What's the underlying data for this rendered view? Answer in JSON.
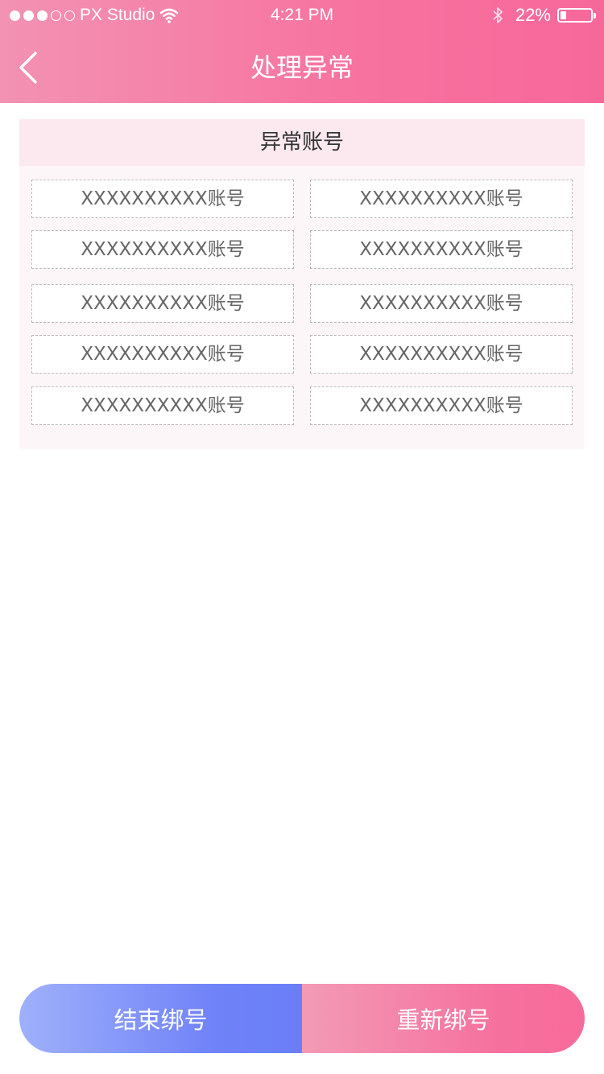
{
  "status_bar": {
    "carrier": "PX Studio",
    "time": "4:21 PM",
    "battery": "22%",
    "signal_icon": "signal-dots-icon",
    "wifi_icon": "wifi-icon",
    "bluetooth_icon": "bluetooth-icon",
    "battery_icon": "battery-icon"
  },
  "nav": {
    "title": "处理异常",
    "back_icon": "chevron-left-icon"
  },
  "panel": {
    "title": "异常账号",
    "accounts": [
      "XXXXXXXXXX账号",
      "XXXXXXXXXX账号",
      "XXXXXXXXXX账号",
      "XXXXXXXXXX账号",
      "XXXXXXXXXX账号",
      "XXXXXXXXXX账号",
      "XXXXXXXXXX账号",
      "XXXXXXXXXX账号",
      "XXXXXXXXXX账号",
      "XXXXXXXXXX账号"
    ]
  },
  "actions": {
    "end_label": "结束绑号",
    "rebind_label": "重新绑号"
  },
  "colors": {
    "header_pink": "#f7729f",
    "panel_header_bg": "#fce9ef",
    "panel_bg": "#fdf6f8",
    "button_blue": "#6f82f8",
    "button_pink": "#f6709e"
  }
}
